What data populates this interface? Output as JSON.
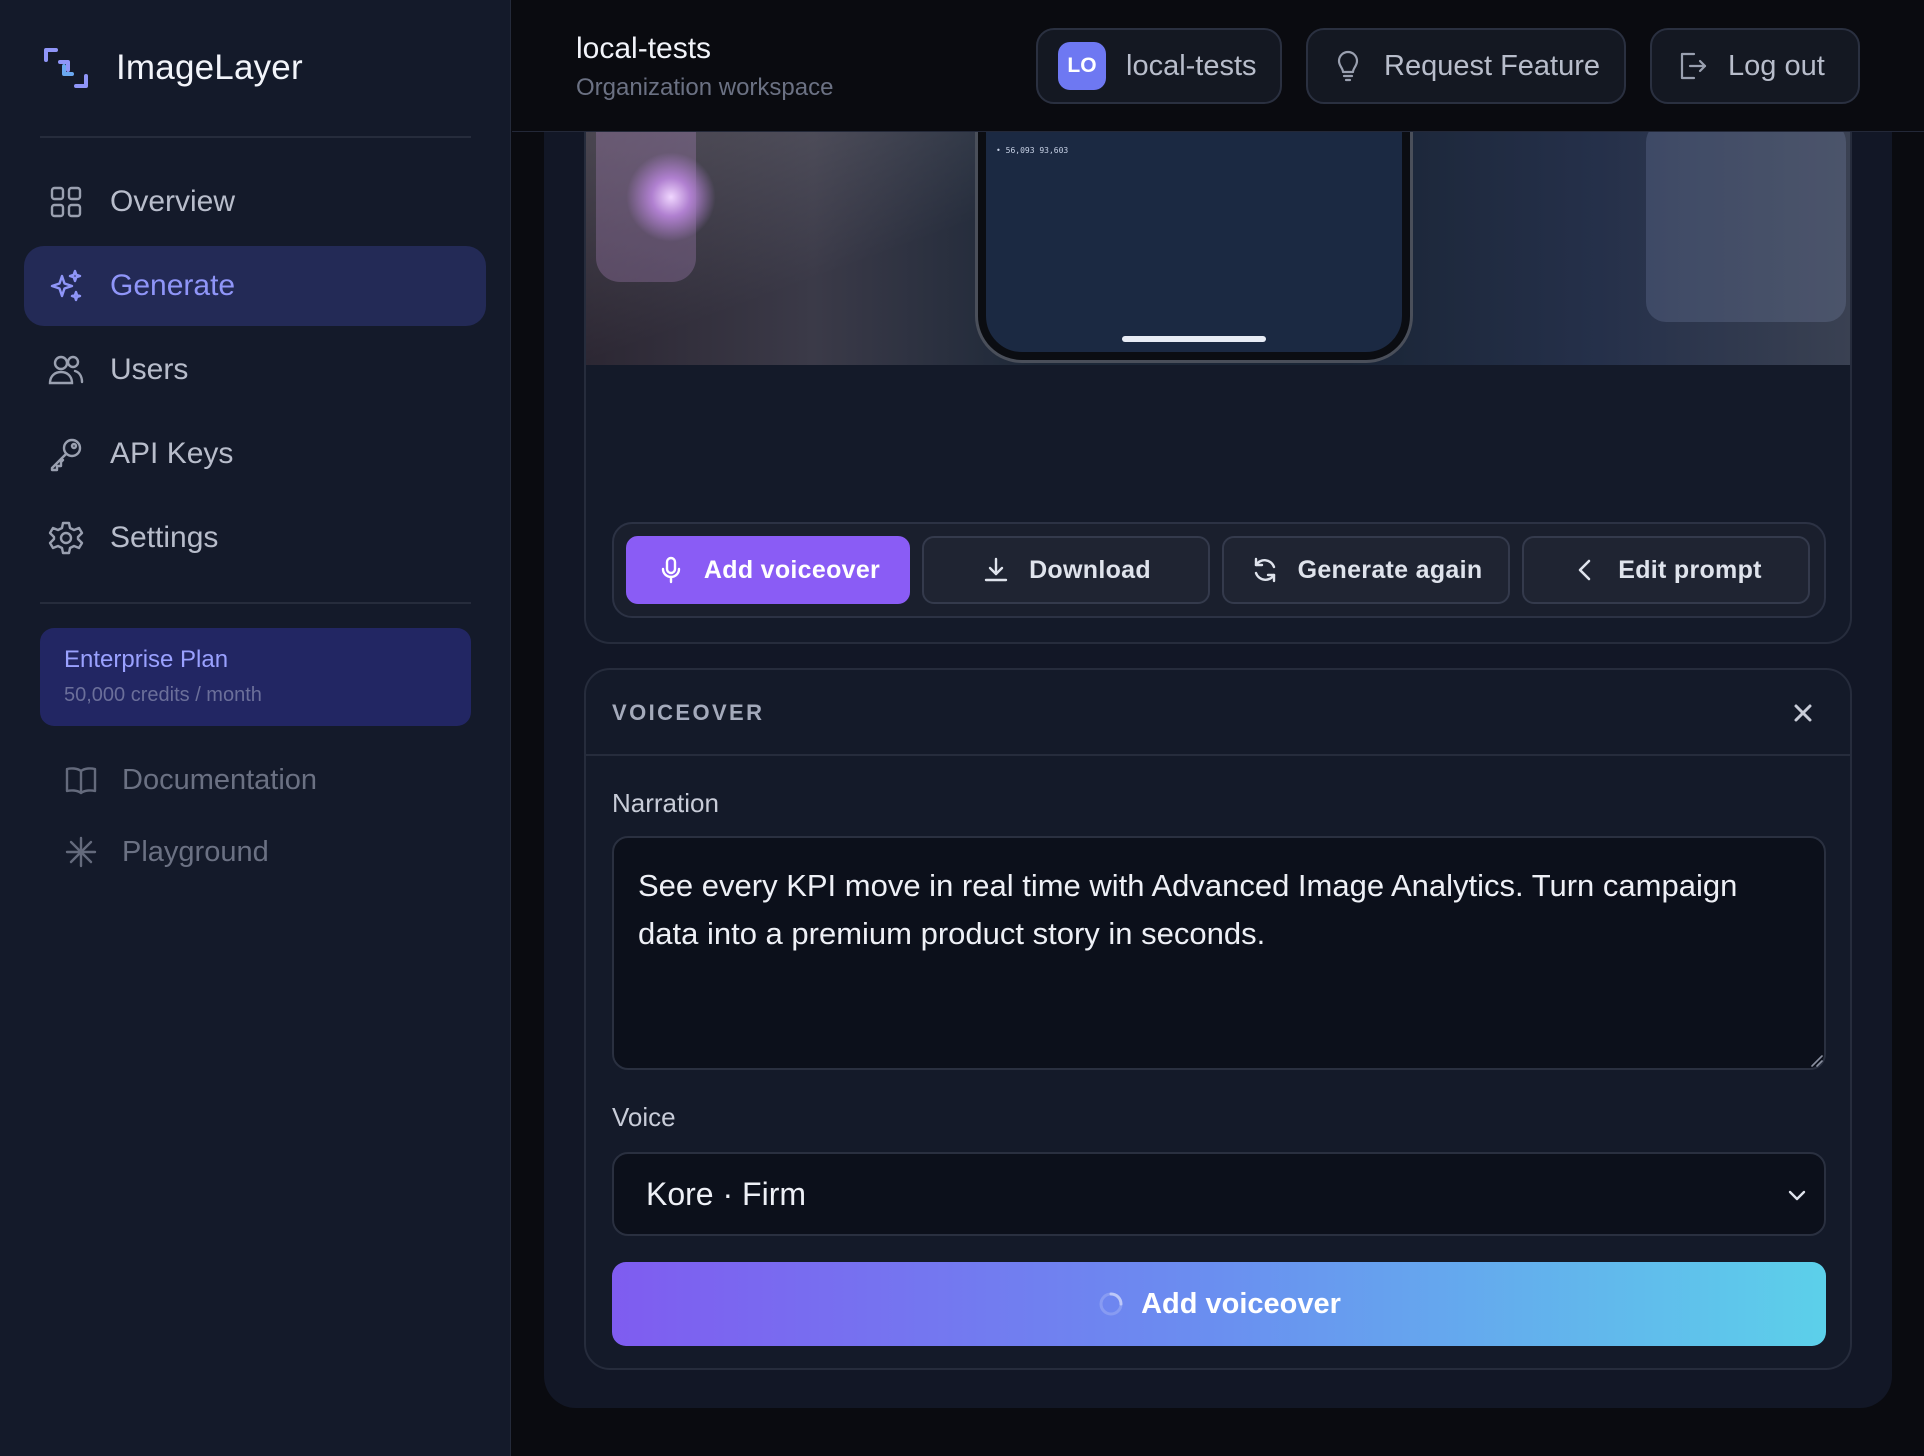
{
  "app": {
    "name": "ImageLayer"
  },
  "sidebar": {
    "items": [
      {
        "label": "Overview",
        "icon": "grid-icon",
        "active": false
      },
      {
        "label": "Generate",
        "icon": "sparkles-icon",
        "active": true
      },
      {
        "label": "Users",
        "icon": "users-icon",
        "active": false
      },
      {
        "label": "API Keys",
        "icon": "key-icon",
        "active": false
      },
      {
        "label": "Settings",
        "icon": "gear-icon",
        "active": false
      }
    ],
    "plan": {
      "name": "Enterprise Plan",
      "credits": "50,000 credits / month"
    },
    "links": [
      {
        "label": "Documentation",
        "icon": "book-icon"
      },
      {
        "label": "Playground",
        "icon": "asterisk-icon"
      }
    ]
  },
  "header": {
    "workspace_title": "local-tests",
    "workspace_subtitle": "Organization workspace",
    "org_badge": "LO",
    "org_name": "local-tests",
    "request_feature": "Request Feature",
    "logout": "Log out"
  },
  "preview": {
    "phone_status": "• 56,093   93,603"
  },
  "actions": {
    "add_voiceover": "Add voiceover",
    "download": "Download",
    "generate_again": "Generate again",
    "edit_prompt": "Edit prompt"
  },
  "voiceover": {
    "title": "VOICEOVER",
    "narration_label": "Narration",
    "narration_text": "See every KPI move in real time with Advanced Image Analytics. Turn campaign data into a premium product story in seconds.",
    "voice_label": "Voice",
    "voice_value": "Kore · Firm",
    "submit": "Add voiceover"
  },
  "colors": {
    "accent": "#8a5cf5",
    "active_nav_bg": "#232a56",
    "active_nav_text": "#8f95f8",
    "plan_bg": "#222663",
    "gradient_start": "#7f5cf0",
    "gradient_end": "#5cd0ea"
  }
}
